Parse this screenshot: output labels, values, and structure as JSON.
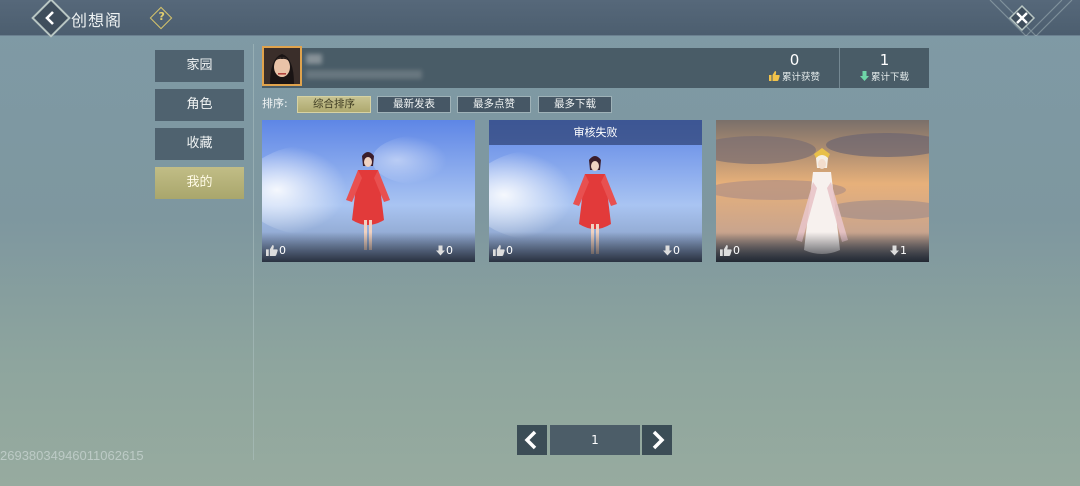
{
  "header": {
    "title": "创想阁",
    "help_glyph": "?"
  },
  "sidebar": {
    "items": [
      {
        "label": "家园",
        "active": false
      },
      {
        "label": "角色",
        "active": false
      },
      {
        "label": "收藏",
        "active": false
      },
      {
        "label": "我的",
        "active": true
      }
    ]
  },
  "profile": {
    "likes_total": "0",
    "likes_label": "累计获赞",
    "downloads_total": "1",
    "downloads_label": "累计下载"
  },
  "sort": {
    "label": "排序:",
    "options": [
      "综合排序",
      "最新发表",
      "最多点赞",
      "最多下载"
    ],
    "selected": "综合排序"
  },
  "works": [
    {
      "likes": "0",
      "downloads": "0",
      "status": ""
    },
    {
      "likes": "0",
      "downloads": "0",
      "status": "审核失败"
    },
    {
      "likes": "0",
      "downloads": "1",
      "status": ""
    }
  ],
  "pagination": {
    "current_page": "1"
  },
  "footer": {
    "uid": "2693803494601106261­5"
  },
  "colors": {
    "active_tab": "#b5b277",
    "panel": "#465866",
    "accent_gold": "#e2cf6f",
    "download_arrow": "#6fd6a8"
  }
}
